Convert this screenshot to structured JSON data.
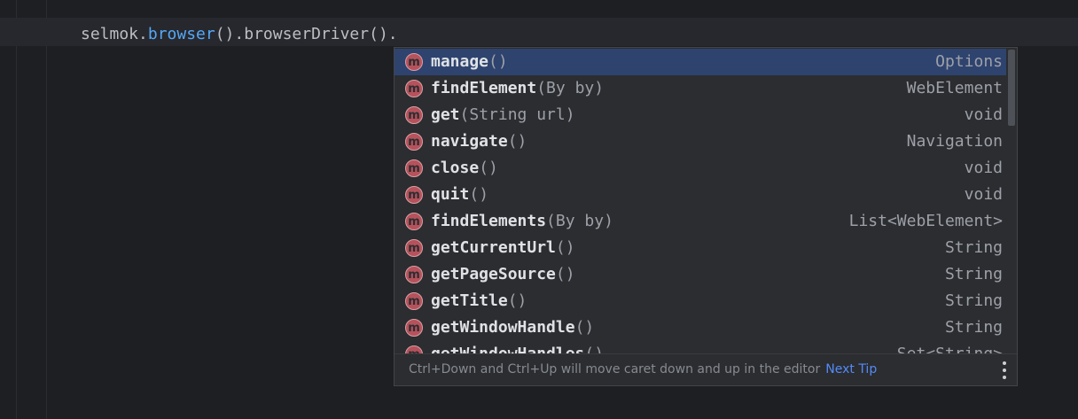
{
  "editor": {
    "code": {
      "prefix": "selmok.",
      "method": "browser",
      "suffix": "().browserDriver()."
    }
  },
  "completion": {
    "icon_letter": "m",
    "items": [
      {
        "name": "manage",
        "params": "()",
        "type": "Options",
        "selected": true
      },
      {
        "name": "findElement",
        "params": "(By by)",
        "type": "WebElement"
      },
      {
        "name": "get",
        "params": "(String url)",
        "type": "void"
      },
      {
        "name": "navigate",
        "params": "()",
        "type": "Navigation"
      },
      {
        "name": "close",
        "params": "()",
        "type": "void"
      },
      {
        "name": "quit",
        "params": "()",
        "type": "void"
      },
      {
        "name": "findElements",
        "params": "(By by)",
        "type": "List<WebElement>"
      },
      {
        "name": "getCurrentUrl",
        "params": "()",
        "type": "String"
      },
      {
        "name": "getPageSource",
        "params": "()",
        "type": "String"
      },
      {
        "name": "getTitle",
        "params": "()",
        "type": "String"
      },
      {
        "name": "getWindowHandle",
        "params": "()",
        "type": "String"
      },
      {
        "name": "getWindowHandles",
        "params": "()",
        "type": "Set<String>"
      }
    ],
    "footer": {
      "tip": "Ctrl+Down and Ctrl+Up will move caret down and up in the editor",
      "next_tip": "Next Tip"
    }
  },
  "colors": {
    "background": "#1e1f22",
    "popup": "#2b2d30",
    "selection": "#2e436e",
    "method_icon": "#b6525c",
    "method_call": "#56a8f5",
    "link": "#548af7"
  }
}
